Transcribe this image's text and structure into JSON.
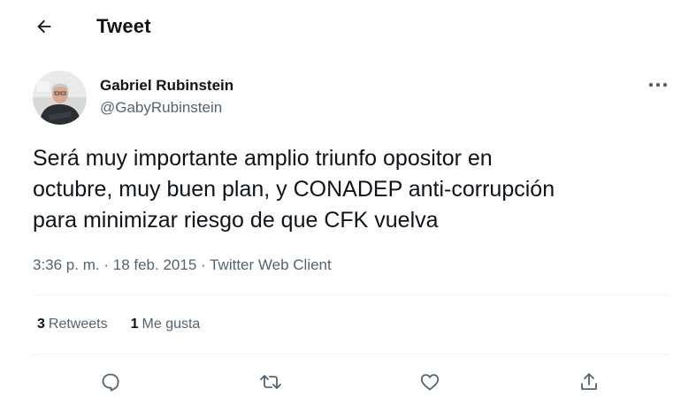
{
  "header": {
    "title": "Tweet",
    "back_icon": "arrow-left-icon"
  },
  "author": {
    "name": "Gabriel Rubinstein",
    "handle": "@GabyRubinstein",
    "avatar_icon": "avatar-photo"
  },
  "tweet": {
    "text_lines": [
      "Será muy importante amplio triunfo opositor en",
      "octubre, muy buen plan, y CONADEP anti-corrupción",
      "para minimizar riesgo de que CFK vuelva"
    ],
    "time": "3:36 p. m.",
    "date": "18 feb. 2015",
    "source": "Twitter Web Client",
    "separator": "·"
  },
  "stats": {
    "retweets_count": "3",
    "retweets_label": "Retweets",
    "likes_count": "1",
    "likes_label": "Me gusta"
  },
  "actions": [
    {
      "icon": "reply-icon"
    },
    {
      "icon": "retweet-icon"
    },
    {
      "icon": "like-icon"
    },
    {
      "icon": "share-icon"
    }
  ],
  "colors": {
    "text": "#0f1419",
    "secondary": "#536471",
    "divider": "#eff3f4"
  }
}
